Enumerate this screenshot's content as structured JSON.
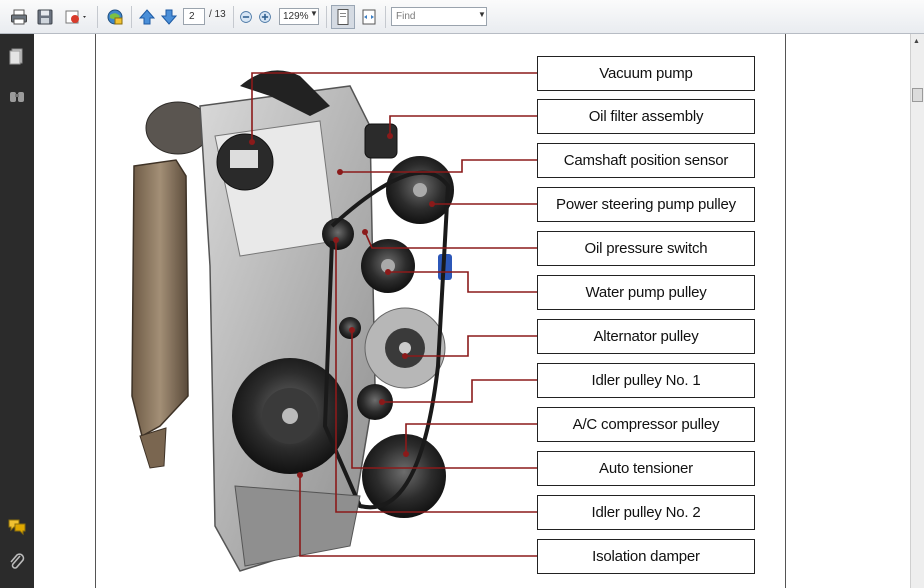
{
  "toolbar": {
    "page_current": "2",
    "page_total": "/ 13",
    "zoom": "129%",
    "find_placeholder": "Find"
  },
  "icons": {
    "print": "printer-icon",
    "save": "save-icon",
    "email": "email-icon",
    "review": "comment-globe-icon",
    "prev": "arrow-up-icon",
    "next": "arrow-down-icon",
    "zoom_out": "zoom-out-icon",
    "zoom_in": "zoom-in-icon",
    "fit_page": "fit-page-icon",
    "fit_width": "fit-width-icon",
    "pages_panel": "pages-panel-icon",
    "bookmarks_panel": "binoculars-icon",
    "comments_panel": "comments-icon",
    "attachments_panel": "paperclip-icon"
  },
  "colors": {
    "leader_line": "#8b1a1a",
    "nav_pane": "#2b2b2b"
  },
  "figure": {
    "labels": [
      "Vacuum pump",
      "Oil filter assembly",
      "Camshaft position sensor",
      "Power steering pump pulley",
      "Oil pressure switch",
      "Water pump pulley",
      "Alternator pulley",
      "Idler pulley No. 1",
      "A/C compressor pulley",
      "Auto tensioner",
      "Idler pulley No. 2",
      "Isolation damper"
    ]
  }
}
